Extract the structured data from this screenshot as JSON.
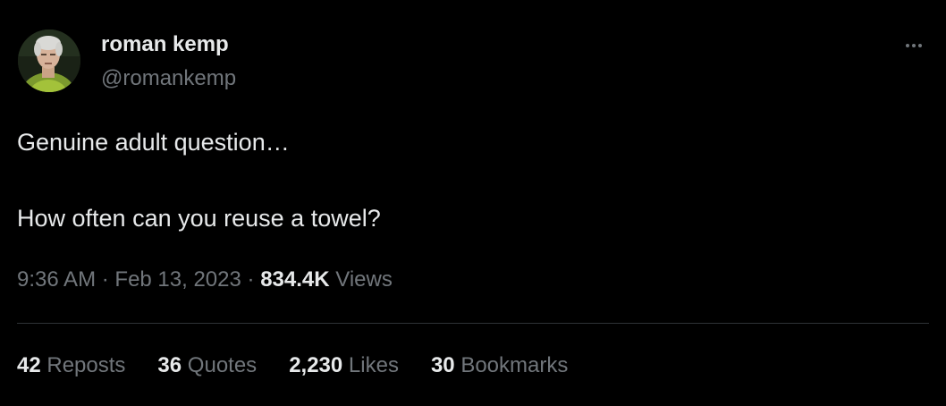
{
  "author": {
    "display_name": "roman kemp",
    "handle": "@romankemp",
    "avatar_icon": "profile-photo"
  },
  "tweet": {
    "lines": [
      "Genuine adult question…",
      "How often can you reuse a towel?"
    ]
  },
  "meta": {
    "time": "9:36 AM",
    "separator": "·",
    "date": "Feb 13, 2023",
    "views_count": "834.4K",
    "views_label": "Views"
  },
  "stats": [
    {
      "count": "42",
      "label": "Reposts"
    },
    {
      "count": "36",
      "label": "Quotes"
    },
    {
      "count": "2,230",
      "label": "Likes"
    },
    {
      "count": "30",
      "label": "Bookmarks"
    }
  ],
  "more_icon": "more-horizontal-icon",
  "colors": {
    "background": "#000000",
    "primary_text": "#e7e9ea",
    "secondary_text": "#71767b",
    "divider": "#2f3336"
  }
}
